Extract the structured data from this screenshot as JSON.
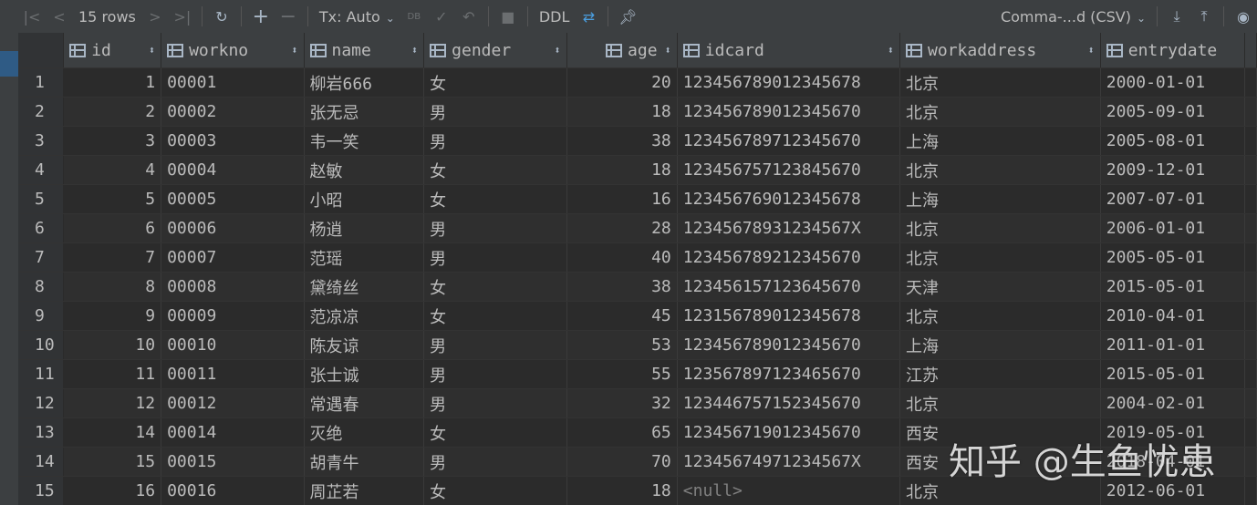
{
  "toolbar": {
    "rows_label": "15 rows",
    "tx_label": "Tx: Auto",
    "ddl_label": "DDL",
    "db_label": "DB",
    "export_format": "Comma-...d (CSV)"
  },
  "columns": [
    "id",
    "workno",
    "name",
    "gender",
    "age",
    "idcard",
    "workaddress",
    "entrydate"
  ],
  "rows": [
    {
      "n": "1",
      "id": "1",
      "workno": "00001",
      "name": "柳岩666",
      "gender": "女",
      "age": "20",
      "idcard": "123456789012345678",
      "workaddress": "北京",
      "entrydate": "2000-01-01"
    },
    {
      "n": "2",
      "id": "2",
      "workno": "00002",
      "name": "张无忌",
      "gender": "男",
      "age": "18",
      "idcard": "123456789012345670",
      "workaddress": "北京",
      "entrydate": "2005-09-01"
    },
    {
      "n": "3",
      "id": "3",
      "workno": "00003",
      "name": "韦一笑",
      "gender": "男",
      "age": "38",
      "idcard": "123456789712345670",
      "workaddress": "上海",
      "entrydate": "2005-08-01"
    },
    {
      "n": "4",
      "id": "4",
      "workno": "00004",
      "name": "赵敏",
      "gender": "女",
      "age": "18",
      "idcard": "123456757123845670",
      "workaddress": "北京",
      "entrydate": "2009-12-01"
    },
    {
      "n": "5",
      "id": "5",
      "workno": "00005",
      "name": "小昭",
      "gender": "女",
      "age": "16",
      "idcard": "123456769012345678",
      "workaddress": "上海",
      "entrydate": "2007-07-01"
    },
    {
      "n": "6",
      "id": "6",
      "workno": "00006",
      "name": "杨逍",
      "gender": "男",
      "age": "28",
      "idcard": "12345678931234567X",
      "workaddress": "北京",
      "entrydate": "2006-01-01"
    },
    {
      "n": "7",
      "id": "7",
      "workno": "00007",
      "name": "范瑶",
      "gender": "男",
      "age": "40",
      "idcard": "123456789212345670",
      "workaddress": "北京",
      "entrydate": "2005-05-01"
    },
    {
      "n": "8",
      "id": "8",
      "workno": "00008",
      "name": "黛绮丝",
      "gender": "女",
      "age": "38",
      "idcard": "123456157123645670",
      "workaddress": "天津",
      "entrydate": "2015-05-01"
    },
    {
      "n": "9",
      "id": "9",
      "workno": "00009",
      "name": "范凉凉",
      "gender": "女",
      "age": "45",
      "idcard": "123156789012345678",
      "workaddress": "北京",
      "entrydate": "2010-04-01"
    },
    {
      "n": "10",
      "id": "10",
      "workno": "00010",
      "name": "陈友谅",
      "gender": "男",
      "age": "53",
      "idcard": "123456789012345670",
      "workaddress": "上海",
      "entrydate": "2011-01-01"
    },
    {
      "n": "11",
      "id": "11",
      "workno": "00011",
      "name": "张士诚",
      "gender": "男",
      "age": "55",
      "idcard": "123567897123465670",
      "workaddress": "江苏",
      "entrydate": "2015-05-01"
    },
    {
      "n": "12",
      "id": "12",
      "workno": "00012",
      "name": "常遇春",
      "gender": "男",
      "age": "32",
      "idcard": "123446757152345670",
      "workaddress": "北京",
      "entrydate": "2004-02-01"
    },
    {
      "n": "13",
      "id": "14",
      "workno": "00014",
      "name": "灭绝",
      "gender": "女",
      "age": "65",
      "idcard": "123456719012345670",
      "workaddress": "西安",
      "entrydate": "2019-05-01"
    },
    {
      "n": "14",
      "id": "15",
      "workno": "00015",
      "name": "胡青牛",
      "gender": "男",
      "age": "70",
      "idcard": "12345674971234567X",
      "workaddress": "西安",
      "entrydate": "2018-04-01"
    },
    {
      "n": "15",
      "id": "16",
      "workno": "00016",
      "name": "周芷若",
      "gender": "女",
      "age": "18",
      "idcard": "<null>",
      "workaddress": "北京",
      "entrydate": "2012-06-01"
    }
  ],
  "watermark": "知乎 @生鱼忧患",
  "colors": {
    "background": "#2b2b2b",
    "toolbar": "#3c3f41",
    "text": "#bbbbbb",
    "null_text": "#808080"
  }
}
